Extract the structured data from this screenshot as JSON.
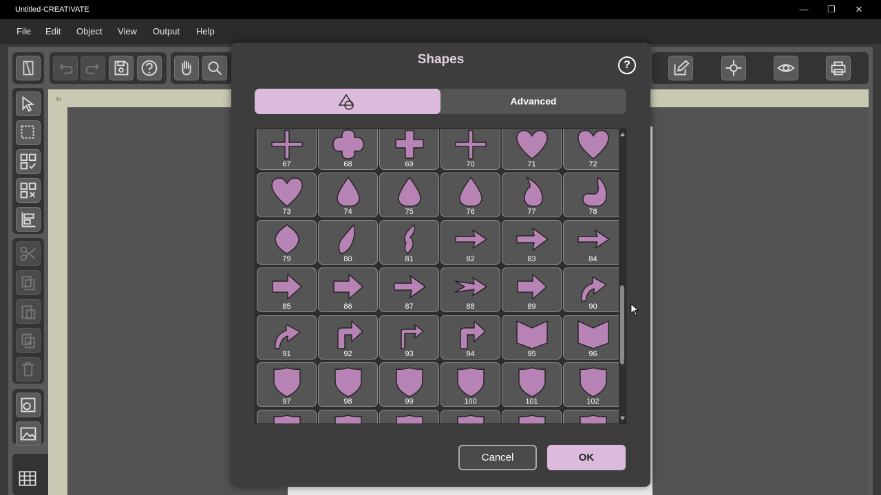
{
  "window": {
    "title": "Untitled-CREATIVATE",
    "minimize": "—",
    "maximize": "❐",
    "close": "✕"
  },
  "menu": [
    "File",
    "Edit",
    "Object",
    "View",
    "Output",
    "Help"
  ],
  "ruler_unit": "in",
  "dialog": {
    "title": "Shapes",
    "help": "?",
    "tabs": {
      "advanced": "Advanced"
    },
    "cancel": "Cancel",
    "ok": "OK",
    "shape_color": "#b783b5",
    "accent": "#dcbadb",
    "shapes": [
      {
        "num": "67",
        "icon": "thin-cross"
      },
      {
        "num": "68",
        "icon": "rounded-cross"
      },
      {
        "num": "69",
        "icon": "cross"
      },
      {
        "num": "70",
        "icon": "thin-cross"
      },
      {
        "num": "71",
        "icon": "heart"
      },
      {
        "num": "72",
        "icon": "heart"
      },
      {
        "num": "73",
        "icon": "heart"
      },
      {
        "num": "74",
        "icon": "drop"
      },
      {
        "num": "75",
        "icon": "drop"
      },
      {
        "num": "76",
        "icon": "drop"
      },
      {
        "num": "77",
        "icon": "curved-drop"
      },
      {
        "num": "78",
        "icon": "crescent-drop"
      },
      {
        "num": "79",
        "icon": "leaf"
      },
      {
        "num": "80",
        "icon": "curved-leaf"
      },
      {
        "num": "81",
        "icon": "s-leaf"
      },
      {
        "num": "82",
        "icon": "thin-arrow"
      },
      {
        "num": "83",
        "icon": "arrow"
      },
      {
        "num": "84",
        "icon": "thin-arrow"
      },
      {
        "num": "85",
        "icon": "block-arrow"
      },
      {
        "num": "86",
        "icon": "block-arrow"
      },
      {
        "num": "87",
        "icon": "arrow"
      },
      {
        "num": "88",
        "icon": "notched-arrow"
      },
      {
        "num": "89",
        "icon": "block-arrow"
      },
      {
        "num": "90",
        "icon": "curved-arrow"
      },
      {
        "num": "91",
        "icon": "curved-arrow"
      },
      {
        "num": "92",
        "icon": "bent-arrow"
      },
      {
        "num": "93",
        "icon": "thin-bent-arrow"
      },
      {
        "num": "94",
        "icon": "bent-arrow"
      },
      {
        "num": "95",
        "icon": "chevron-banner"
      },
      {
        "num": "96",
        "icon": "chevron-banner"
      },
      {
        "num": "97",
        "icon": "shield"
      },
      {
        "num": "98",
        "icon": "shield"
      },
      {
        "num": "99",
        "icon": "shield"
      },
      {
        "num": "100",
        "icon": "shield"
      },
      {
        "num": "101",
        "icon": "shield"
      },
      {
        "num": "102",
        "icon": "shield"
      },
      {
        "num": "",
        "icon": "shield"
      },
      {
        "num": "",
        "icon": "shield"
      },
      {
        "num": "",
        "icon": "shield"
      },
      {
        "num": "",
        "icon": "shield"
      },
      {
        "num": "",
        "icon": "shield"
      },
      {
        "num": "",
        "icon": "shield"
      }
    ]
  }
}
